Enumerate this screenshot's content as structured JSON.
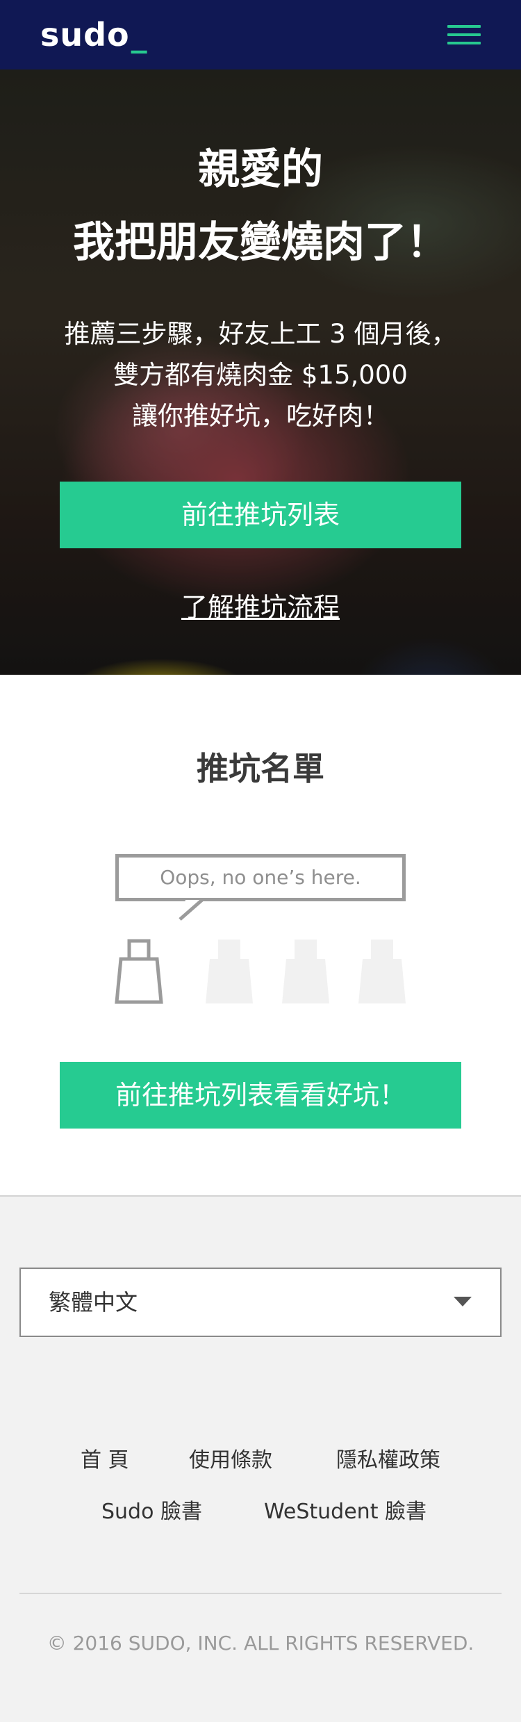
{
  "navbar": {
    "brand": "sudo",
    "brand_cursor": "_",
    "menu_icon": "hamburger-icon",
    "accent_color": "#27c990",
    "background_color": "#101854"
  },
  "hero": {
    "title_line1": "親愛的",
    "title_line2": "我把朋友變燒肉了！",
    "subtitle_line1": "推薦三步驟，好友上工 3 個月後，",
    "subtitle_line2": "雙方都有燒肉金 $15,000",
    "subtitle_line3": "讓你推好坑，吃好肉！",
    "cta_label": "前往推坑列表",
    "link_label": "了解推坑流程"
  },
  "referral_list": {
    "title": "推坑名單",
    "empty_message": "Oops, no one’s here.",
    "slot_icons": [
      "bag-outline-icon",
      "bag-placeholder-icon",
      "bag-placeholder-icon",
      "bag-placeholder-icon"
    ],
    "cta_label": "前往推坑列表看看好坑！"
  },
  "footer": {
    "language_select": {
      "selected": "繁體中文",
      "icon": "chevron-down-icon"
    },
    "links": {
      "home": "首 頁",
      "terms": "使用條款",
      "privacy": "隱私權政策",
      "sudo_facebook": "Sudo 臉書",
      "westudent_facebook": "WeStudent 臉書"
    },
    "copyright": "© 2016 SUDO, INC. ALL RIGHTS RESERVED."
  },
  "colors": {
    "button_green": "#26cb91",
    "footer_background": "#f2f2f2"
  }
}
